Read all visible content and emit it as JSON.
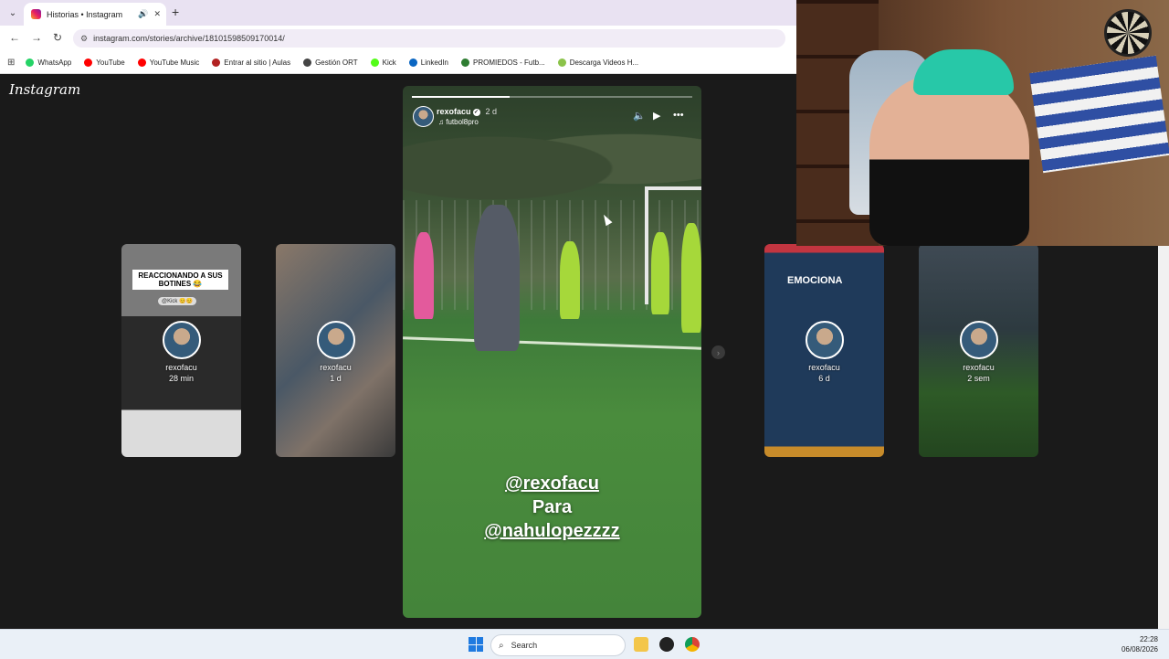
{
  "browser": {
    "tab": {
      "title": "Historias • Instagram"
    },
    "url": "instagram.com/stories/archive/18101598509170014/",
    "bookmarks": [
      {
        "label": "WhatsApp",
        "color": "#25d366"
      },
      {
        "label": "YouTube",
        "color": "#ff0000"
      },
      {
        "label": "YouTube Music",
        "color": "#ff0000"
      },
      {
        "label": "Entrar al sitio | Aulas",
        "color": "#b22222"
      },
      {
        "label": "Gestión ORT",
        "color": "#444444"
      },
      {
        "label": "Kick",
        "color": "#53fc18"
      },
      {
        "label": "LinkedIn",
        "color": "#0a66c2"
      },
      {
        "label": "PROMIEDOS - Futb...",
        "color": "#2e7d32"
      },
      {
        "label": "Descarga Videos H...",
        "color": "#8bc34a"
      }
    ]
  },
  "instagram": {
    "logo": "Instagram",
    "thumbnails": [
      {
        "caption": "REACCIONANDO A SUS BOTINES 😂",
        "sub": "@Kick 😊😊",
        "user": "rexofacu",
        "time": "28 min"
      },
      {
        "caption": "",
        "sub": "",
        "user": "rexofacu",
        "time": "1 d"
      },
      {
        "caption": "EMOCIONA",
        "sub": "",
        "user": "rexofacu",
        "time": "6 d"
      },
      {
        "caption": "",
        "sub": "",
        "user": "rexofacu",
        "time": "2 sem"
      }
    ],
    "story": {
      "user": "rexofacu",
      "time": "2 d",
      "audio": "futbol8pro",
      "progress": 0.35,
      "mention1": "@rexofacu",
      "mention2": "Para",
      "mention3": "@nahulopezzzz",
      "icons": [
        "volume-icon",
        "play-icon",
        "more-icon"
      ]
    }
  },
  "taskbar": {
    "search": "Search",
    "time": "22:28",
    "date": "06/08/2026"
  }
}
